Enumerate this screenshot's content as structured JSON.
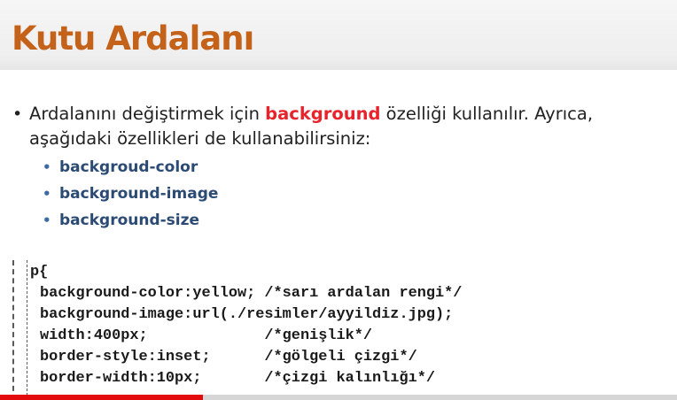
{
  "slide": {
    "title": "Kutu Ardalanı",
    "bullet_intro": "Ardalanını değiştirmek için ",
    "bullet_keyword": "background",
    "bullet_rest": " özelliği kullanılır. Ayrıca, aşağıdaki özellikleri de kullanabilirsiniz:",
    "sub_items": [
      "backgroud-color",
      "background-image",
      "background-size"
    ],
    "code_lines": [
      "p{",
      "background-color:yellow; /*sarı ardalan rengi*/",
      "background-image:url(./resimler/ayyildiz.jpg);",
      "width:400px;             /*genişlik*/",
      "border-style:inset;      /*gölgeli çizgi*/",
      "border-width:10px;       /*çizgi kalınlığı*/"
    ],
    "colors": {
      "title": "#c5621a",
      "keyword": "#e8232c",
      "sub_items": "#2b4a74",
      "progress": "#e30b0b"
    }
  },
  "video": {
    "progress_fraction": 0.3
  }
}
